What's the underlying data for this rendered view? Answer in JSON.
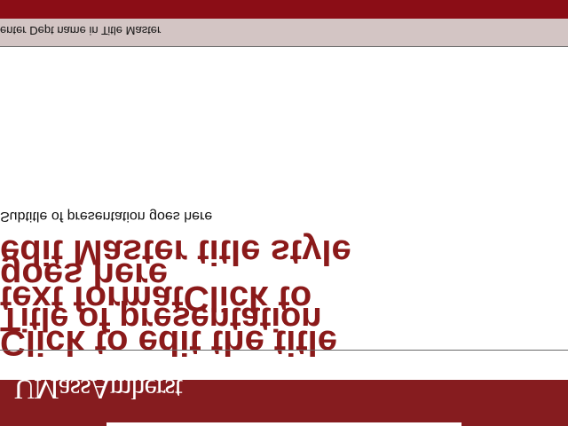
{
  "header": {
    "dept_text": "enter Dept name in Title Master"
  },
  "slide": {
    "subtitle": "Subtitle of presentation goes here",
    "title_lines": [
      "edit Master title style",
      "goes here",
      "text formatClick to",
      "Title of presentation",
      "Click to edit the title"
    ]
  },
  "footer": {
    "brand": "UMassAmherst"
  },
  "colors": {
    "top_bar": "#8b0d16",
    "dept_band": "#d3c5c4",
    "title_text": "#8b1a1a",
    "bottom_band": "#861c1f"
  }
}
